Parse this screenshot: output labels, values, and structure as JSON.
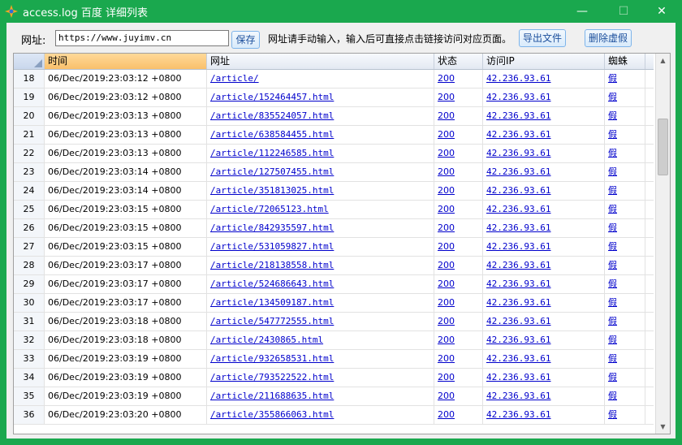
{
  "window": {
    "title": "access.log 百度 详细列表",
    "minimize_glyph": "—",
    "maximize_glyph": "☐",
    "close_glyph": "✕"
  },
  "toolbar": {
    "url_label": "网址:",
    "url_value": "https://www.juyimv.cn",
    "save_label": "保存",
    "hint": "网址请手动输入，输入后可直接点击链接访问对应页面。",
    "export_label": "导出文件",
    "delete_label": "删除虚假"
  },
  "table": {
    "headers": [
      "时间",
      "网址",
      "状态",
      "访问IP",
      "蜘蛛"
    ],
    "rows": [
      {
        "num": "18",
        "time": "06/Dec/2019:23:03:12 +0800",
        "url": "/article/",
        "status": "200",
        "ip": "42.236.93.61",
        "spider": "假"
      },
      {
        "num": "19",
        "time": "06/Dec/2019:23:03:12 +0800",
        "url": "/article/152464457.html",
        "status": "200",
        "ip": "42.236.93.61",
        "spider": "假"
      },
      {
        "num": "20",
        "time": "06/Dec/2019:23:03:13 +0800",
        "url": "/article/835524057.html",
        "status": "200",
        "ip": "42.236.93.61",
        "spider": "假"
      },
      {
        "num": "21",
        "time": "06/Dec/2019:23:03:13 +0800",
        "url": "/article/638584455.html",
        "status": "200",
        "ip": "42.236.93.61",
        "spider": "假"
      },
      {
        "num": "22",
        "time": "06/Dec/2019:23:03:13 +0800",
        "url": "/article/112246585.html",
        "status": "200",
        "ip": "42.236.93.61",
        "spider": "假"
      },
      {
        "num": "23",
        "time": "06/Dec/2019:23:03:14 +0800",
        "url": "/article/127507455.html",
        "status": "200",
        "ip": "42.236.93.61",
        "spider": "假"
      },
      {
        "num": "24",
        "time": "06/Dec/2019:23:03:14 +0800",
        "url": "/article/351813025.html",
        "status": "200",
        "ip": "42.236.93.61",
        "spider": "假"
      },
      {
        "num": "25",
        "time": "06/Dec/2019:23:03:15 +0800",
        "url": "/article/72065123.html",
        "status": "200",
        "ip": "42.236.93.61",
        "spider": "假"
      },
      {
        "num": "26",
        "time": "06/Dec/2019:23:03:15 +0800",
        "url": "/article/842935597.html",
        "status": "200",
        "ip": "42.236.93.61",
        "spider": "假"
      },
      {
        "num": "27",
        "time": "06/Dec/2019:23:03:15 +0800",
        "url": "/article/531059827.html",
        "status": "200",
        "ip": "42.236.93.61",
        "spider": "假"
      },
      {
        "num": "28",
        "time": "06/Dec/2019:23:03:17 +0800",
        "url": "/article/218138558.html",
        "status": "200",
        "ip": "42.236.93.61",
        "spider": "假"
      },
      {
        "num": "29",
        "time": "06/Dec/2019:23:03:17 +0800",
        "url": "/article/524686643.html",
        "status": "200",
        "ip": "42.236.93.61",
        "spider": "假"
      },
      {
        "num": "30",
        "time": "06/Dec/2019:23:03:17 +0800",
        "url": "/article/134509187.html",
        "status": "200",
        "ip": "42.236.93.61",
        "spider": "假"
      },
      {
        "num": "31",
        "time": "06/Dec/2019:23:03:18 +0800",
        "url": "/article/547772555.html",
        "status": "200",
        "ip": "42.236.93.61",
        "spider": "假"
      },
      {
        "num": "32",
        "time": "06/Dec/2019:23:03:18 +0800",
        "url": "/article/2430865.html",
        "status": "200",
        "ip": "42.236.93.61",
        "spider": "假"
      },
      {
        "num": "33",
        "time": "06/Dec/2019:23:03:19 +0800",
        "url": "/article/932658531.html",
        "status": "200",
        "ip": "42.236.93.61",
        "spider": "假"
      },
      {
        "num": "34",
        "time": "06/Dec/2019:23:03:19 +0800",
        "url": "/article/793522522.html",
        "status": "200",
        "ip": "42.236.93.61",
        "spider": "假"
      },
      {
        "num": "35",
        "time": "06/Dec/2019:23:03:19 +0800",
        "url": "/article/211688635.html",
        "status": "200",
        "ip": "42.236.93.61",
        "spider": "假"
      },
      {
        "num": "36",
        "time": "06/Dec/2019:23:03:20 +0800",
        "url": "/article/355866063.html",
        "status": "200",
        "ip": "42.236.93.61",
        "spider": "假"
      }
    ]
  },
  "colors": {
    "titlebar": "#1aa84e",
    "active_header": "#f9c06b",
    "link": "#0000cc"
  },
  "icons": {
    "app": "app-icon",
    "scroll_up": "▲",
    "scroll_down": "▼"
  }
}
